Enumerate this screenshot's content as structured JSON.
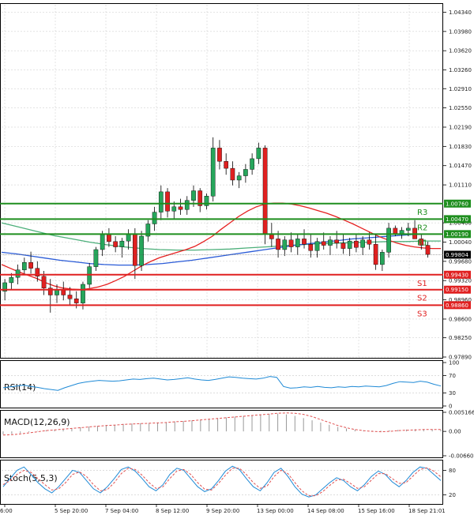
{
  "chart_data": {
    "type": "candlestick",
    "y_ticks": [
      "1.04340",
      "1.03980",
      "1.03620",
      "1.03260",
      "1.02910",
      "1.02550",
      "1.02190",
      "1.01830",
      "1.01470",
      "1.01110",
      "1.00400",
      "1.00040",
      "0.99680",
      "0.99320",
      "0.98960",
      "0.98600",
      "0.98250",
      "0.97890"
    ],
    "ylim": [
      0.9789,
      1.0448
    ],
    "x_ticks": [
      "6:00",
      "5 Sep 20:00",
      "7 Sep 04:00",
      "8 Sep 12:00",
      "9 Sep 20:00",
      "13 Sep 00:00",
      "14 Sep 08:00",
      "15 Sep 16:00",
      "18 Sep 21:01"
    ],
    "current_price": "0.99804",
    "colors": {
      "up": "#26a65b",
      "down": "#e02020",
      "ma_red": "#e62020",
      "ma_blue": "#2a5bd7",
      "ma_green": "#4caf7a",
      "resistance": "#1e8e1e",
      "support": "#e02020",
      "indicator": "#1f8ad6",
      "macd_signal": "#e05050"
    },
    "levels": [
      {
        "label": "R3",
        "value": 1.0076,
        "badge": "1.00760",
        "type": "resistance"
      },
      {
        "label": "R2",
        "value": 1.0047,
        "badge": "1.00470",
        "type": "resistance"
      },
      {
        "label": "R1",
        "value": 1.0019,
        "badge": "1.00190",
        "type": "resistance"
      },
      {
        "label": "S1",
        "value": 0.9943,
        "badge": "0.99430",
        "type": "support"
      },
      {
        "label": "S2",
        "value": 0.9915,
        "badge": "0.99150",
        "type": "support"
      },
      {
        "label": "S3",
        "value": 0.9886,
        "badge": "0.98860",
        "type": "support"
      }
    ],
    "candles": [
      [
        0.9912,
        0.9935,
        0.9895,
        0.9928
      ],
      [
        0.9928,
        0.9946,
        0.9915,
        0.9938
      ],
      [
        0.9938,
        0.9962,
        0.9925,
        0.9952
      ],
      [
        0.9952,
        0.9975,
        0.9945,
        0.9966
      ],
      [
        0.9966,
        0.9986,
        0.9945,
        0.9955
      ],
      [
        0.9955,
        0.9968,
        0.993,
        0.994
      ],
      [
        0.994,
        0.995,
        0.9905,
        0.9918
      ],
      [
        0.9918,
        0.9935,
        0.9872,
        0.9905
      ],
      [
        0.9905,
        0.9925,
        0.989,
        0.9915
      ],
      [
        0.9915,
        0.993,
        0.9895,
        0.9905
      ],
      [
        0.9905,
        0.992,
        0.9885,
        0.9898
      ],
      [
        0.9898,
        0.9912,
        0.988,
        0.989
      ],
      [
        0.989,
        0.993,
        0.9878,
        0.9925
      ],
      [
        0.9925,
        0.9965,
        0.9918,
        0.9958
      ],
      [
        0.9958,
        0.9995,
        0.995,
        0.999
      ],
      [
        0.999,
        1.0025,
        0.9978,
        1.0018
      ],
      [
        1.0018,
        1.003,
        0.9995,
        1.0005
      ],
      [
        1.0005,
        1.0015,
        0.9985,
        0.9995
      ],
      [
        0.9995,
        1.0012,
        0.9975,
        1.0006
      ],
      [
        1.0006,
        1.0028,
        0.999,
        1.002
      ],
      [
        1.002,
        1.003,
        0.9935,
        0.996
      ],
      [
        0.996,
        1.0025,
        0.995,
        1.0015
      ],
      [
        1.0015,
        1.0045,
        1.0005,
        1.0038
      ],
      [
        1.0038,
        1.007,
        1.0025,
        1.006
      ],
      [
        1.006,
        1.011,
        1.0045,
        1.0098
      ],
      [
        1.0098,
        1.0105,
        1.005,
        1.0062
      ],
      [
        1.0062,
        1.008,
        1.0048,
        1.007
      ],
      [
        1.007,
        1.0085,
        1.0055,
        1.0065
      ],
      [
        1.0065,
        1.009,
        1.0055,
        1.0082
      ],
      [
        1.0082,
        1.011,
        1.007,
        1.01
      ],
      [
        1.01,
        1.0105,
        1.006,
        1.0072
      ],
      [
        1.0072,
        1.0095,
        1.0065,
        1.009
      ],
      [
        1.009,
        1.02,
        1.008,
        1.018
      ],
      [
        1.018,
        1.0195,
        1.014,
        1.0155
      ],
      [
        1.0155,
        1.017,
        1.013,
        1.0142
      ],
      [
        1.0142,
        1.0155,
        1.011,
        1.012
      ],
      [
        1.012,
        1.0135,
        1.0105,
        1.0128
      ],
      [
        1.0128,
        1.015,
        1.0115,
        1.014
      ],
      [
        1.014,
        1.017,
        1.013,
        1.016
      ],
      [
        1.016,
        1.019,
        1.015,
        1.018
      ],
      [
        1.018,
        1.0185,
        1.0,
        1.002
      ],
      [
        1.002,
        1.004,
        0.9995,
        1.001
      ],
      [
        1.001,
        1.0025,
        0.9975,
        0.999
      ],
      [
        0.999,
        1.0015,
        0.9978,
        1.0008
      ],
      [
        1.0008,
        1.0022,
        0.9985,
        0.9995
      ],
      [
        0.9995,
        1.0018,
        0.998,
        1.001
      ],
      [
        1.001,
        1.0028,
        0.9992,
        1.0
      ],
      [
        1.0,
        1.002,
        0.9975,
        0.9988
      ],
      [
        0.9988,
        1.0012,
        0.9975,
        1.0005
      ],
      [
        1.0005,
        1.0022,
        0.999,
        0.9998
      ],
      [
        0.9998,
        1.0015,
        0.998,
        1.0008
      ],
      [
        1.0008,
        1.0025,
        0.9992,
        1.0002
      ],
      [
        1.0002,
        1.0018,
        0.9982,
        0.9992
      ],
      [
        0.9992,
        1.0012,
        0.9978,
        1.0006
      ],
      [
        1.0006,
        1.002,
        0.9985,
        0.9994
      ],
      [
        0.9994,
        1.0015,
        0.998,
        1.0008
      ],
      [
        1.0008,
        1.0022,
        0.999,
        1.0
      ],
      [
        1.0,
        1.0018,
        0.9952,
        0.9962
      ],
      [
        0.9962,
        0.999,
        0.995,
        0.9985
      ],
      [
        0.9985,
        1.004,
        0.9975,
        1.003
      ],
      [
        1.003,
        1.0035,
        1.0015,
        1.002
      ],
      [
        1.002,
        1.0032,
        1.001,
        1.0026
      ],
      [
        1.0026,
        1.004,
        1.0015,
        1.003
      ],
      [
        1.003,
        1.0045,
        1.0015,
        1.001
      ],
      [
        1.001,
        1.002,
        0.999,
        0.9998
      ],
      [
        0.9998,
        1.0005,
        0.9975,
        0.9981
      ]
    ],
    "ma_red": [
      0.9962,
      0.9955,
      0.9948,
      0.9942,
      0.9936,
      0.9928,
      0.9922,
      0.9918,
      0.9916,
      0.9915,
      0.9917,
      0.992,
      0.9925,
      0.9932,
      0.994,
      0.995,
      0.996,
      0.9968,
      0.9975,
      0.998,
      0.9985,
      0.999,
      0.9996,
      1.0005,
      1.0015,
      1.0028,
      1.004,
      1.0052,
      1.0062,
      1.007,
      1.0075,
      1.0077,
      1.0077,
      1.0075,
      1.0072,
      1.0068,
      1.0063,
      1.0058,
      1.0052,
      1.0045,
      1.0038,
      1.003,
      1.0022,
      1.0014,
      1.0008,
      1.0002,
      0.9998,
      0.9995,
      0.9993,
      0.9992,
      0.9992
    ],
    "ma_blue": [
      0.9985,
      0.9982,
      0.9978,
      0.9974,
      0.997,
      0.9967,
      0.9964,
      0.9962,
      0.9961,
      0.9961,
      0.9962,
      0.9964,
      0.9967,
      0.997,
      0.9974,
      0.9978,
      0.9982,
      0.9986,
      0.999,
      0.9994,
      0.9998,
      1.0001,
      1.0004,
      1.0007,
      1.001,
      1.0012,
      1.0014,
      1.0016,
      1.0018,
      1.0019,
      1.0019
    ],
    "ma_green": [
      1.004,
      1.0032,
      1.0024,
      1.0016,
      1.001,
      1.0004,
      0.9999,
      0.9995,
      0.9992,
      0.999,
      0.9989,
      0.9989,
      0.999,
      0.9991,
      0.9993,
      0.9995,
      0.9997,
      0.9999,
      1.0001,
      1.0002,
      1.0003,
      1.0004,
      1.0005,
      1.0005,
      1.0006,
      1.0006
    ],
    "rsi": {
      "label": "RSI(14)",
      "ticks": [
        "100",
        "70",
        "30",
        "0"
      ],
      "values": [
        42,
        44,
        46,
        48,
        45,
        43,
        40,
        38,
        36,
        42,
        47,
        52,
        55,
        57,
        59,
        58,
        57,
        58,
        60,
        62,
        61,
        63,
        64,
        62,
        60,
        61,
        63,
        65,
        62,
        60,
        59,
        61,
        64,
        67,
        66,
        64,
        63,
        62,
        64,
        68,
        66,
        45,
        41,
        42,
        44,
        43,
        45,
        43,
        42,
        44,
        43,
        45,
        44,
        46,
        45,
        44,
        47,
        52,
        56,
        55,
        54,
        57,
        55,
        50,
        46
      ]
    },
    "macd": {
      "label": "MACD(12,26,9)",
      "ticks": [
        "0.005166",
        "0.00",
        "-0.006608"
      ],
      "histogram": [
        -0.0008,
        -0.0007,
        -0.0005,
        -0.0002,
        0.0001,
        0.0003,
        0.0005,
        0.0007,
        0.0009,
        0.0011,
        0.0013,
        0.0015,
        0.0017,
        0.0018,
        0.002,
        0.0021,
        0.0022,
        0.0023,
        0.0024,
        0.0025,
        0.0027,
        0.0028,
        0.003,
        0.0032,
        0.0034,
        0.0036,
        0.0038,
        0.004,
        0.0042,
        0.0044,
        0.0046,
        0.0047,
        0.0048,
        0.0046,
        0.0042,
        0.0036,
        0.003,
        0.0024,
        0.0018,
        0.0012,
        0.0008,
        0.0005,
        0.0003,
        0.0002,
        0.0002,
        0.0003,
        0.0004,
        0.0005,
        0.0006,
        0.0006,
        0.0006,
        0.0005
      ],
      "signal": [
        -0.001,
        -0.0009,
        -0.0007,
        -0.0004,
        -0.0001,
        0.0002,
        0.0004,
        0.0006,
        0.0008,
        0.001,
        0.0012,
        0.0014,
        0.0016,
        0.0017,
        0.0019,
        0.002,
        0.0021,
        0.0022,
        0.0023,
        0.0024,
        0.0026,
        0.0027,
        0.0029,
        0.0031,
        0.0033,
        0.0035,
        0.0037,
        0.0039,
        0.0041,
        0.0043,
        0.0045,
        0.0047,
        0.0049,
        0.005,
        0.0049,
        0.0046,
        0.004,
        0.0032,
        0.0024,
        0.0016,
        0.001,
        0.0005,
        0.0002,
        0.0,
        -0.0001,
        0.0,
        0.0002,
        0.0003,
        0.0004,
        0.0005,
        0.0005,
        0.0005
      ]
    },
    "stoch": {
      "label": "Stoch(5,5,3)",
      "ticks": [
        "80",
        "20"
      ],
      "main": [
        40,
        60,
        80,
        88,
        70,
        50,
        35,
        25,
        40,
        60,
        80,
        75,
        55,
        35,
        25,
        40,
        60,
        82,
        88,
        78,
        60,
        40,
        30,
        45,
        70,
        85,
        80,
        60,
        40,
        28,
        35,
        55,
        78,
        90,
        82,
        60,
        40,
        30,
        50,
        75,
        85,
        65,
        40,
        22,
        15,
        20,
        35,
        50,
        62,
        55,
        40,
        30,
        45,
        65,
        78,
        70,
        52,
        40,
        55,
        75,
        88,
        85,
        70,
        55
      ],
      "signal": [
        45,
        55,
        70,
        80,
        75,
        60,
        45,
        32,
        35,
        50,
        70,
        76,
        65,
        45,
        30,
        33,
        50,
        72,
        85,
        82,
        68,
        50,
        36,
        40,
        60,
        78,
        82,
        70,
        50,
        34,
        32,
        48,
        68,
        85,
        85,
        70,
        50,
        36,
        42,
        65,
        80,
        72,
        50,
        30,
        18,
        18,
        28,
        43,
        56,
        58,
        48,
        36,
        40,
        56,
        72,
        72,
        60,
        48,
        50,
        66,
        82,
        86,
        78,
        64
      ]
    }
  }
}
